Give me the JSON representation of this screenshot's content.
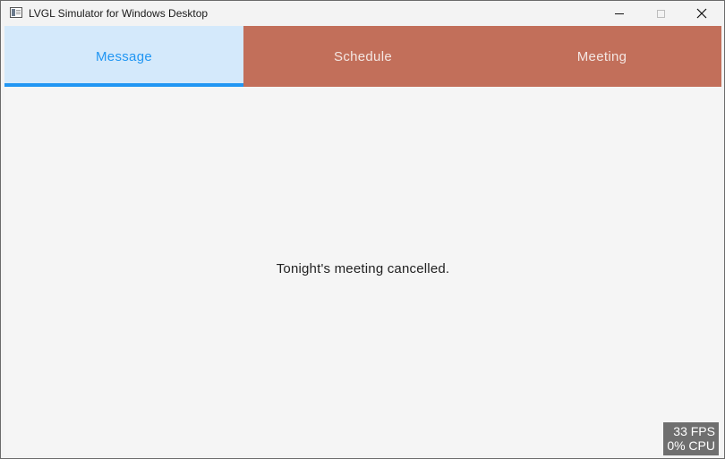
{
  "window": {
    "title": "LVGL Simulator for Windows Desktop",
    "icons": {
      "app": "window-app-icon",
      "minimize": "minimize-icon",
      "maximize": "maximize-icon",
      "close": "close-icon"
    },
    "close_glyph": "✕"
  },
  "tabs": [
    {
      "label": "Message",
      "active": true
    },
    {
      "label": "Schedule",
      "active": false
    },
    {
      "label": "Meeting",
      "active": false
    }
  ],
  "content": {
    "message": "Tonight's meeting cancelled."
  },
  "perf_monitor": {
    "fps": "33 FPS",
    "cpu": "0% CPU"
  },
  "colors": {
    "tab_bar": "#c26f5a",
    "active_tab_bg": "#d4e9fb",
    "accent": "#2196f3",
    "content_bg": "#f5f5f5",
    "perf_bg": "#6f6f6f"
  }
}
